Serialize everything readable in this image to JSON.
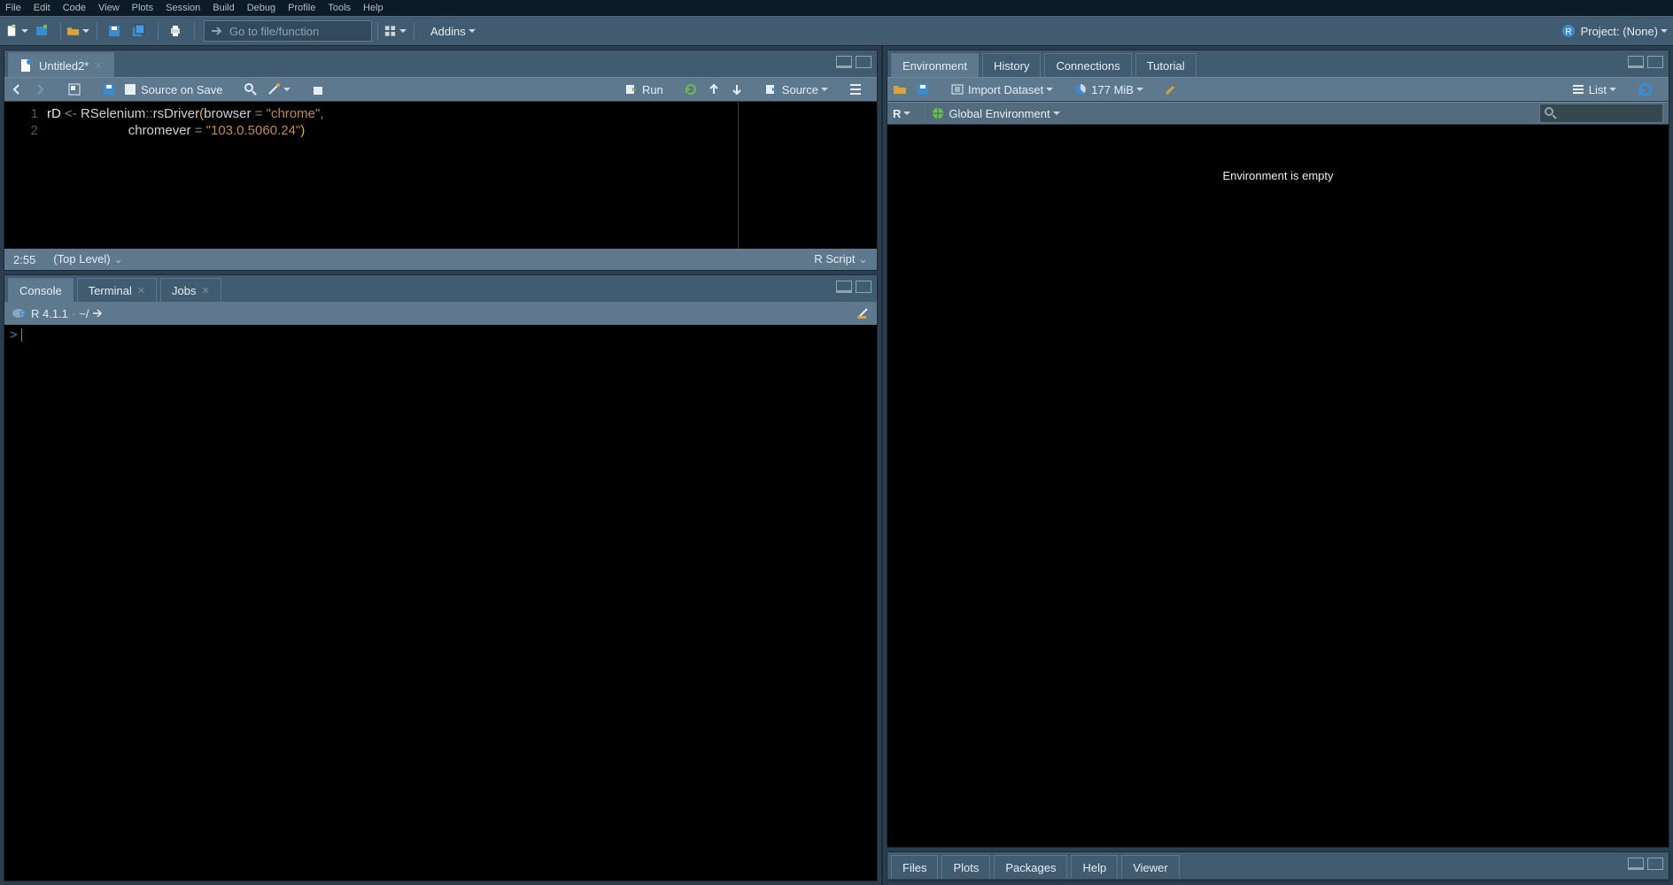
{
  "menu": {
    "items": [
      "File",
      "Edit",
      "Code",
      "View",
      "Plots",
      "Session",
      "Build",
      "Debug",
      "Profile",
      "Tools",
      "Help"
    ]
  },
  "toolbar": {
    "goto_placeholder": "Go to file/function",
    "addins_label": "Addins",
    "project_label": "Project: (None)"
  },
  "source": {
    "tab_title": "Untitled2*",
    "source_on_save": "Source on Save",
    "run_label": "Run",
    "source_label": "Source",
    "line_numbers": [
      "1",
      "2"
    ],
    "code_lines": [
      [
        {
          "t": "rD ",
          "c": "tk-id"
        },
        {
          "t": "<- ",
          "c": "tk-op"
        },
        {
          "t": "RSelenium",
          "c": "tk-ns"
        },
        {
          "t": "::",
          "c": "tk-op"
        },
        {
          "t": "rsDriver",
          "c": "tk-fn"
        },
        {
          "t": "(",
          "c": "tk-par"
        },
        {
          "t": "browser ",
          "c": "tk-arg"
        },
        {
          "t": "= ",
          "c": "tk-eq"
        },
        {
          "t": "\"chrome\"",
          "c": "tk-str"
        },
        {
          "t": ",",
          "c": "tk-pn"
        }
      ],
      [
        {
          "t": "                      ",
          "c": "tk-id"
        },
        {
          "t": "chromever ",
          "c": "tk-arg"
        },
        {
          "t": "= ",
          "c": "tk-eq"
        },
        {
          "t": "\"103.0.5060.24\"",
          "c": "tk-str"
        },
        {
          "t": ")",
          "c": "tk-par"
        }
      ]
    ],
    "cursor_pos": "2:55",
    "scope": "(Top Level)",
    "lang": "R Script"
  },
  "console_tabs": {
    "console": "Console",
    "terminal": "Terminal",
    "jobs": "Jobs"
  },
  "console": {
    "version": "R 4.1.1",
    "cwd": "~/",
    "prompt": "> "
  },
  "env": {
    "tabs": {
      "environment": "Environment",
      "history": "History",
      "connections": "Connections",
      "tutorial": "Tutorial"
    },
    "import_label": "Import Dataset",
    "memory": "177 MiB",
    "list_label": "List",
    "scope_lang": "R",
    "scope": "Global Environment",
    "empty_msg": "Environment is empty"
  },
  "misc_tabs": {
    "files": "Files",
    "plots": "Plots",
    "packages": "Packages",
    "help": "Help",
    "viewer": "Viewer"
  }
}
